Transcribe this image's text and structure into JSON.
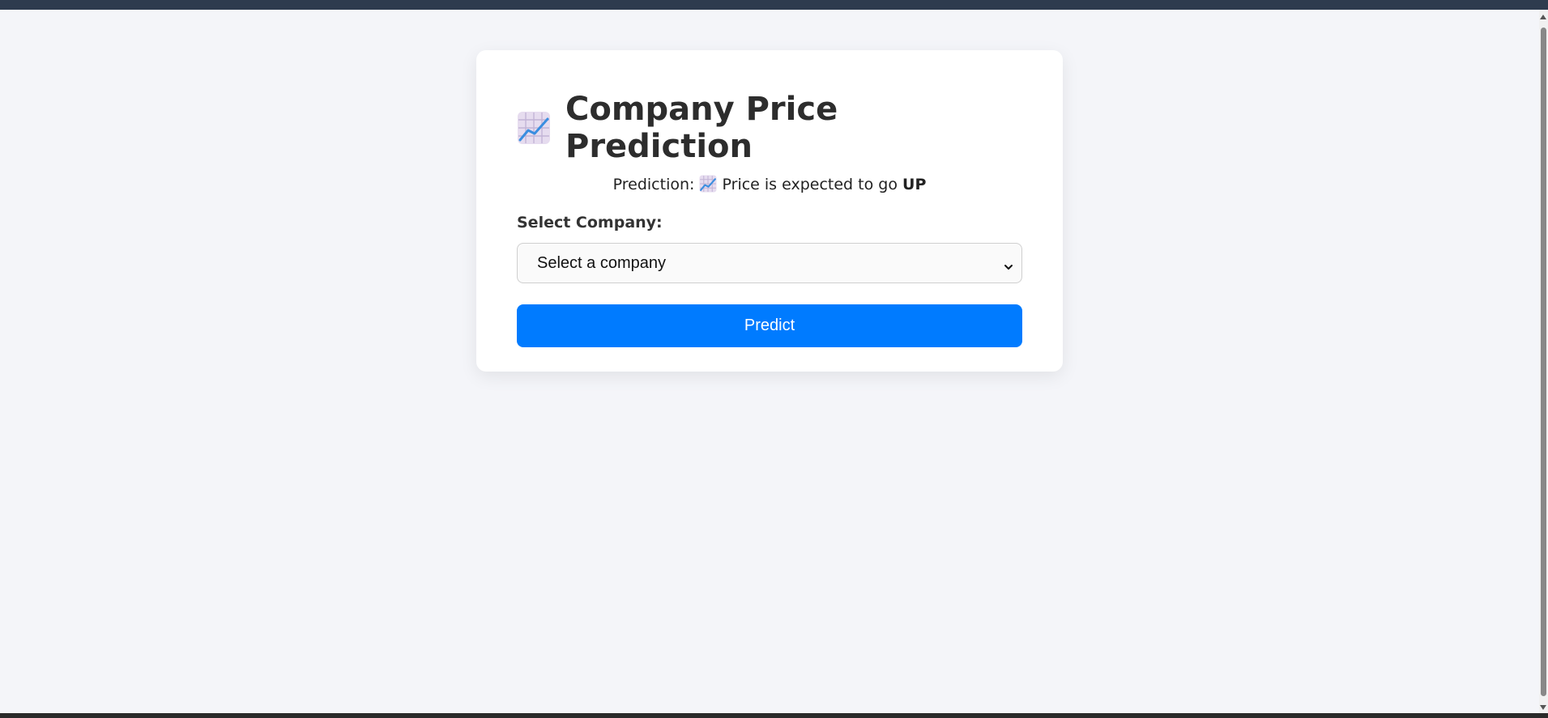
{
  "header": {
    "title": "Company Price Prediction",
    "icon": "chart-increasing-icon"
  },
  "prediction": {
    "prefix": "Prediction:",
    "icon": "chart-increasing-icon",
    "message": "Price is expected to go",
    "result": "UP"
  },
  "form": {
    "label": "Select Company:",
    "select_value": "Select a company",
    "button_label": "Predict"
  },
  "colors": {
    "accent": "#007bff",
    "background": "#f4f5f9",
    "top_bar": "#2e3b4e"
  }
}
